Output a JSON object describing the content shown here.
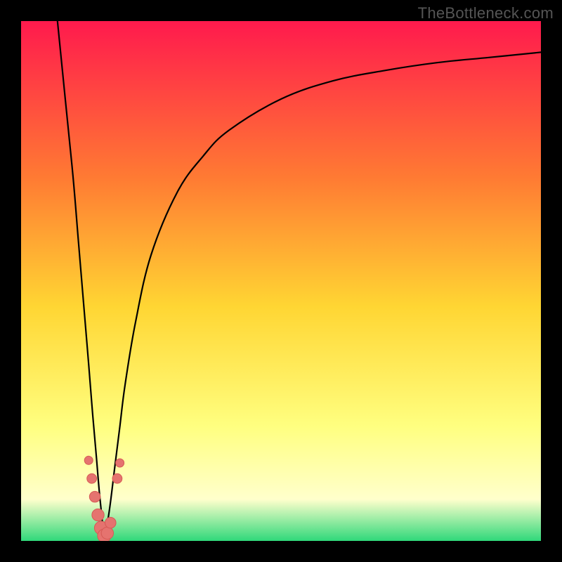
{
  "watermark": "TheBottleneck.com",
  "chart_data": {
    "type": "line",
    "title": "",
    "xlabel": "",
    "ylabel": "",
    "xlim": [
      0,
      100
    ],
    "ylim": [
      0,
      100
    ],
    "grid": false,
    "legend": false,
    "gradient_colors": {
      "top": "#ff1a4d",
      "mid_upper": "#ff7a33",
      "mid": "#ffd633",
      "mid_lower": "#ffff80",
      "lower_band": "#ffffcc",
      "bottom": "#2fd87a"
    },
    "series": [
      {
        "name": "left-branch",
        "x": [
          7.0,
          8.5,
          10.0,
          11.0,
          12.0,
          13.0,
          13.8,
          14.5,
          15.0,
          15.5,
          16.0
        ],
        "y": [
          100,
          85,
          70,
          58,
          46,
          34,
          24,
          16,
          10,
          5,
          0
        ]
      },
      {
        "name": "right-branch",
        "x": [
          16.0,
          17.0,
          18.0,
          19.0,
          20.0,
          22.0,
          25.0,
          30.0,
          35.0,
          40.0,
          50.0,
          60.0,
          70.0,
          80.0,
          90.0,
          100.0
        ],
        "y": [
          0,
          6,
          14,
          22,
          30,
          42,
          55,
          67,
          74,
          79,
          85,
          88.5,
          90.5,
          92,
          93,
          94
        ]
      }
    ],
    "markers": [
      {
        "x": 13.0,
        "y": 15.5
      },
      {
        "x": 13.6,
        "y": 12.0
      },
      {
        "x": 14.2,
        "y": 8.5
      },
      {
        "x": 14.8,
        "y": 5.0
      },
      {
        "x": 15.4,
        "y": 2.5
      },
      {
        "x": 16.0,
        "y": 1.0
      },
      {
        "x": 16.6,
        "y": 1.5
      },
      {
        "x": 17.2,
        "y": 3.5
      },
      {
        "x": 18.5,
        "y": 12.0
      },
      {
        "x": 19.0,
        "y": 15.0
      }
    ],
    "marker_style": {
      "fill": "#e5736f",
      "stroke": "#d65a55",
      "r_min": 6,
      "r_max": 10
    }
  }
}
